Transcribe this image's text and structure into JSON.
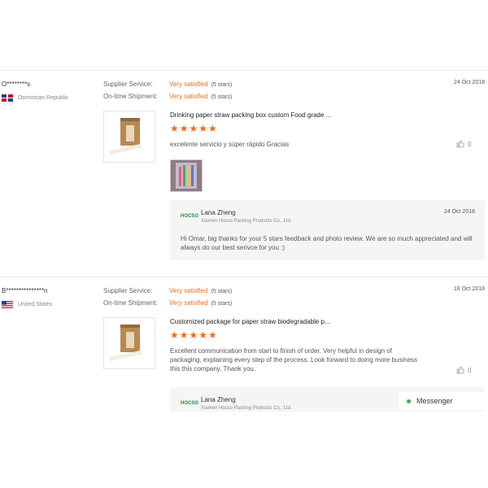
{
  "labels": {
    "supplier_service": "Supplier Service:",
    "ontime_shipment": "On-time Shipment:"
  },
  "reviews": [
    {
      "buyer": "O********s",
      "country": "Dominican Republic",
      "date": "24 Oct 2018",
      "supplier_rating": "Very satisfied",
      "supplier_stars": "(5 stars)",
      "shipment_rating": "Very satisfied",
      "shipment_stars": "(5 stars)",
      "product_title": "Drinking paper straw packing box custom Food grade ...",
      "stars": "★★★★★",
      "comment": "excelente servicio y súper rápido Gracias",
      "likes": "0",
      "reply": {
        "logo": "HOCSO",
        "name": "Lana Zheng",
        "company": "Xiamen Hocso Packing Products Co., Ltd.",
        "date": "24 Oct 2018",
        "text": "Hi Omar, big thanks for your 5 stars feedback and photo review. We are so much appreciated and will always do our best serivce for you :)"
      }
    },
    {
      "buyer": "B***************n",
      "country": "United States",
      "date": "18 Oct 2018",
      "supplier_rating": "Very satisfied",
      "supplier_stars": "(5 stars)",
      "shipment_rating": "Very satisfied",
      "shipment_stars": "(5 stars)",
      "product_title": "Customized package for paper straw biodegradable p...",
      "stars": "★★★★★",
      "comment": "Excellent communication from start to finish of order. Very helpful in design of packaging, explaining every step of the process. Look forward to doing more business this this company. Thank you.",
      "likes": "0",
      "reply": {
        "logo": "HOCSO",
        "name": "Lana Zheng",
        "company": "Xiamen Hocso Packing Products Co., Ltd."
      }
    }
  ],
  "messenger": {
    "label": "Messenger",
    "status_color": "#36b24a"
  },
  "colors": {
    "accent": "#f06a1a"
  },
  "icons": [
    "thumb-up-icon",
    "messenger-status-icon"
  ]
}
